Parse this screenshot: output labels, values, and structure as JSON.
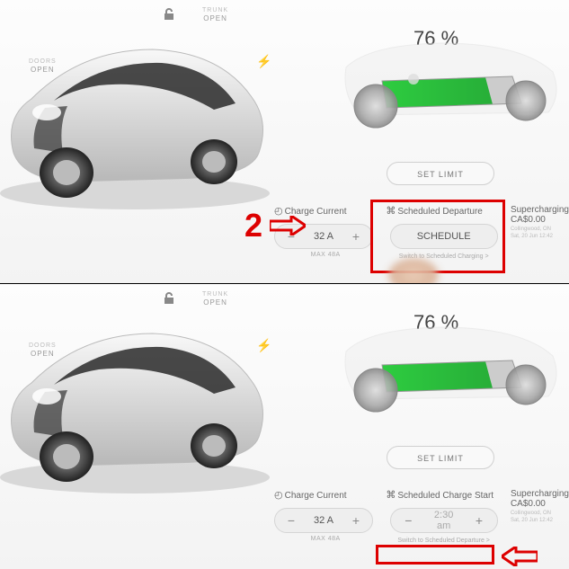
{
  "vehicle": {
    "doors_label": "OPEN",
    "doors_sub": "DOORS",
    "trunk_label": "OPEN",
    "trunk_sub": "TRUNK"
  },
  "charge": {
    "percent": "76 %",
    "set_limit": "SET LIMIT",
    "current_title": "Charge Current",
    "current_value": "32 A",
    "current_max": "MAX 48A"
  },
  "top": {
    "sched_title": "Scheduled Departure",
    "sched_btn": "SCHEDULE",
    "switch": "Switch to Scheduled Charging >"
  },
  "bottom": {
    "sched_title": "Scheduled Charge Start",
    "sched_time": "2:30 am",
    "switch": "Switch to Scheduled Departure >"
  },
  "super": {
    "title": "Supercharging",
    "amount": "CA$0.00",
    "loc": "Collingwood, ON",
    "date": "Sat, 20 Jun 12:42"
  },
  "annot": {
    "step": "2"
  }
}
